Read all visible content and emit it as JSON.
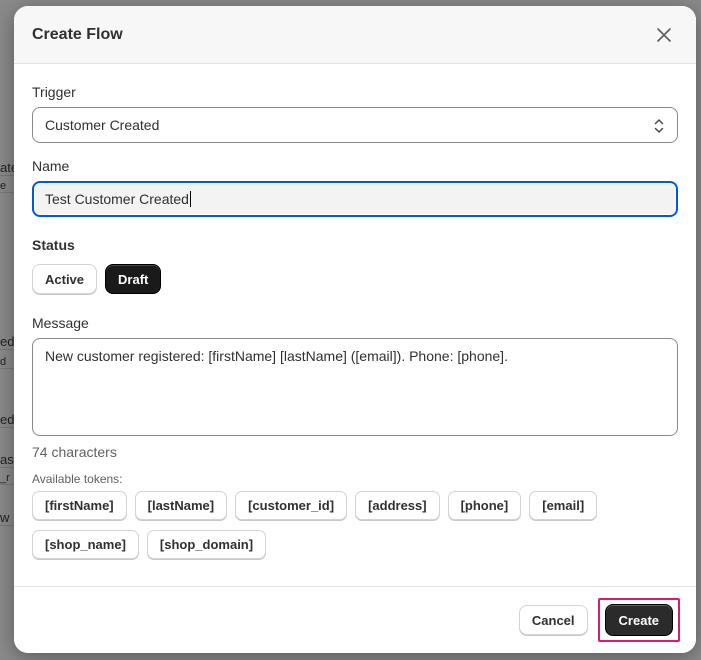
{
  "background_rows": [
    "ate",
    "e",
    "ed",
    "d",
    "ed",
    "as",
    "_r",
    "w"
  ],
  "modal": {
    "title": "Create Flow",
    "trigger": {
      "label": "Trigger",
      "value": "Customer Created"
    },
    "name": {
      "label": "Name",
      "value": "Test Customer Created"
    },
    "status": {
      "label": "Status",
      "options": [
        "Active",
        "Draft"
      ],
      "selected": "Draft"
    },
    "message": {
      "label": "Message",
      "value": "New customer registered: [firstName] [lastName] ([email]). Phone: [phone].",
      "count": "74 characters"
    },
    "tokens": {
      "label": "Available tokens:",
      "items": [
        "[firstName]",
        "[lastName]",
        "[customer_id]",
        "[address]",
        "[phone]",
        "[email]",
        "[shop_name]",
        "[shop_domain]"
      ]
    },
    "footer": {
      "cancel": "Cancel",
      "create": "Create"
    }
  },
  "colors": {
    "focus": "#005bd3",
    "highlight": "#e0176f",
    "primary": "#2b2b2b"
  }
}
